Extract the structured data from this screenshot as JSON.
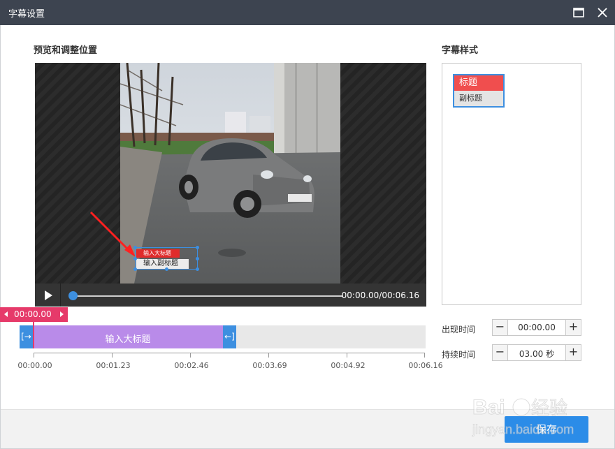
{
  "window": {
    "title": "字幕设置",
    "maximize_icon": "maximize-icon",
    "close_icon": "close-icon"
  },
  "preview": {
    "section_title": "预览和调整位置",
    "overlay_title": "输入大标题",
    "overlay_subtitle": "输入副标题",
    "play_icon": "play-icon",
    "progress": 0,
    "timecode": "00:00.00/00:06.16"
  },
  "timeline": {
    "playhead_time": "00:00.00",
    "clip_label": "输入大标题",
    "ruler_labels": [
      "00:00.00",
      "00:01.23",
      "00:02.46",
      "00:03.69",
      "00:04.92",
      "00:06.16"
    ]
  },
  "styles": {
    "section_title": "字幕样式",
    "selected_style": {
      "title": "标题",
      "subtitle": "副标题"
    }
  },
  "fields": {
    "appear_time": {
      "label": "出现时间",
      "value": "00:00.00",
      "minus": "−",
      "plus": "+"
    },
    "duration": {
      "label": "持续时间",
      "value": "03.00 秒",
      "minus": "−",
      "plus": "+"
    }
  },
  "footer": {
    "save_label": "保存"
  },
  "watermark": {
    "brand": "Baidu",
    "brand_cn": "经验",
    "url": "jingyan.baidu.com"
  },
  "colors": {
    "accent": "#3d8fe0",
    "clip": "#b98be9",
    "playhead": "#e63a6a",
    "title_red": "#f04e4e",
    "titlebar": "#3d4450"
  }
}
